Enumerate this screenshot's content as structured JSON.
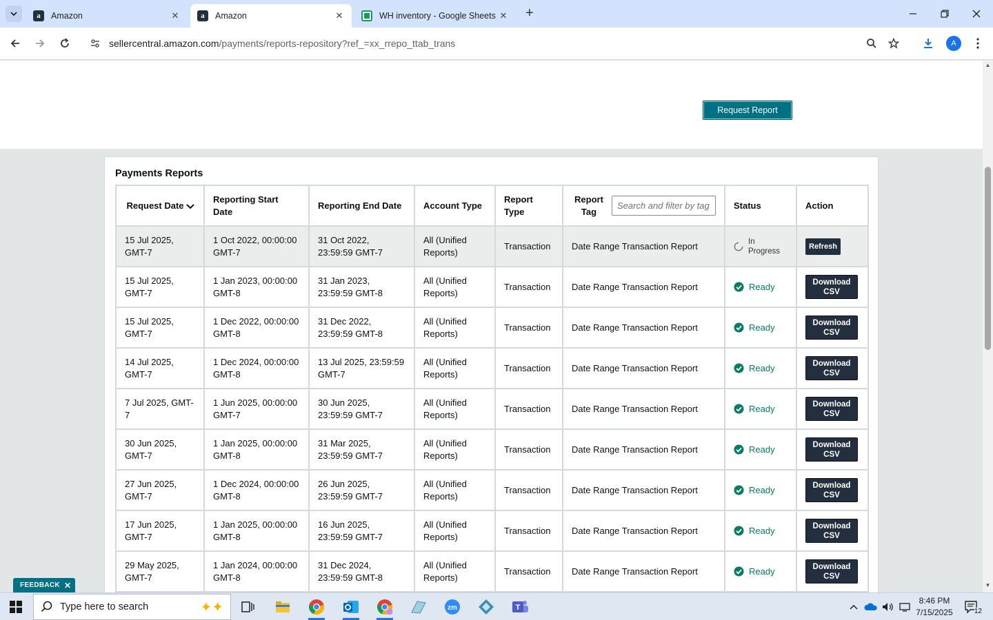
{
  "browser": {
    "tabs": [
      {
        "title": "Amazon",
        "icon": "amazon-favicon",
        "active": false
      },
      {
        "title": "Amazon",
        "icon": "amazon-favicon",
        "active": true
      },
      {
        "title": "WH inventory - Google Sheets",
        "icon": "google-sheets-favicon",
        "active": false
      }
    ],
    "url_host": "sellercentral.amazon.com",
    "url_path": "/payments/reports-repository?ref_=xx_rrepo_ttab_trans",
    "profile_initial": "A"
  },
  "page": {
    "request_report_label": "Request Report",
    "panel_title": "Payments Reports",
    "feedback_label": "FEEDBACK",
    "table": {
      "headers": {
        "request_date": "Request Date",
        "start_date": "Reporting Start Date",
        "end_date": "Reporting End Date",
        "account_type": "Account Type",
        "report_type": "Report Type",
        "report_tag": "Report Tag",
        "status": "Status",
        "action": "Action"
      },
      "tag_filter_placeholder": "Search and filter by tag",
      "rows": [
        {
          "request_date": "15 Jul 2025, GMT-7",
          "start": "1 Oct 2022, 00:00:00 GMT-7",
          "end": "31 Oct 2022, 23:59:59 GMT-7",
          "account": "All (Unified Reports)",
          "type": "Transaction",
          "tag": "Date Range Transaction Report",
          "status": "In Progress",
          "action": "Refresh"
        },
        {
          "request_date": "15 Jul 2025, GMT-7",
          "start": "1 Jan 2023, 00:00:00 GMT-8",
          "end": "31 Jan 2023, 23:59:59 GMT-8",
          "account": "All (Unified Reports)",
          "type": "Transaction",
          "tag": "Date Range Transaction Report",
          "status": "Ready",
          "action": "Download CSV"
        },
        {
          "request_date": "15 Jul 2025, GMT-7",
          "start": "1 Dec 2022, 00:00:00 GMT-8",
          "end": "31 Dec 2022, 23:59:59 GMT-8",
          "account": "All (Unified Reports)",
          "type": "Transaction",
          "tag": "Date Range Transaction Report",
          "status": "Ready",
          "action": "Download CSV"
        },
        {
          "request_date": "14 Jul 2025, GMT-7",
          "start": "1 Dec 2024, 00:00:00 GMT-8",
          "end": "13 Jul 2025, 23:59:59 GMT-7",
          "account": "All (Unified Reports)",
          "type": "Transaction",
          "tag": "Date Range Transaction Report",
          "status": "Ready",
          "action": "Download CSV"
        },
        {
          "request_date": "7 Jul 2025, GMT-7",
          "start": "1 Jun 2025, 00:00:00 GMT-7",
          "end": "30 Jun 2025, 23:59:59 GMT-7",
          "account": "All (Unified Reports)",
          "type": "Transaction",
          "tag": "Date Range Transaction Report",
          "status": "Ready",
          "action": "Download CSV"
        },
        {
          "request_date": "30 Jun 2025, GMT-7",
          "start": "1 Jan 2025, 00:00:00 GMT-8",
          "end": "31 Mar 2025, 23:59:59 GMT-7",
          "account": "All (Unified Reports)",
          "type": "Transaction",
          "tag": "Date Range Transaction Report",
          "status": "Ready",
          "action": "Download CSV"
        },
        {
          "request_date": "27 Jun 2025, GMT-7",
          "start": "1 Dec 2024, 00:00:00 GMT-8",
          "end": "26 Jun 2025, 23:59:59 GMT-7",
          "account": "All (Unified Reports)",
          "type": "Transaction",
          "tag": "Date Range Transaction Report",
          "status": "Ready",
          "action": "Download CSV"
        },
        {
          "request_date": "17 Jun 2025, GMT-7",
          "start": "1 Jan 2025, 00:00:00 GMT-8",
          "end": "16 Jun 2025, 23:59:59 GMT-7",
          "account": "All (Unified Reports)",
          "type": "Transaction",
          "tag": "Date Range Transaction Report",
          "status": "Ready",
          "action": "Download CSV"
        },
        {
          "request_date": "29 May 2025, GMT-7",
          "start": "1 Jan 2024, 00:00:00 GMT-8",
          "end": "31 Dec 2024, 23:59:59 GMT-8",
          "account": "All (Unified Reports)",
          "type": "Transaction",
          "tag": "Date Range Transaction Report",
          "status": "Ready",
          "action": "Download CSV"
        }
      ]
    }
  },
  "taskbar": {
    "search_placeholder": "Type here to search",
    "time": "8:46 PM",
    "date": "7/15/2025",
    "notification_count": "12"
  },
  "colors": {
    "accent_teal": "#007185",
    "ready_green": "#067d62",
    "dark_button": "#232f3e"
  }
}
